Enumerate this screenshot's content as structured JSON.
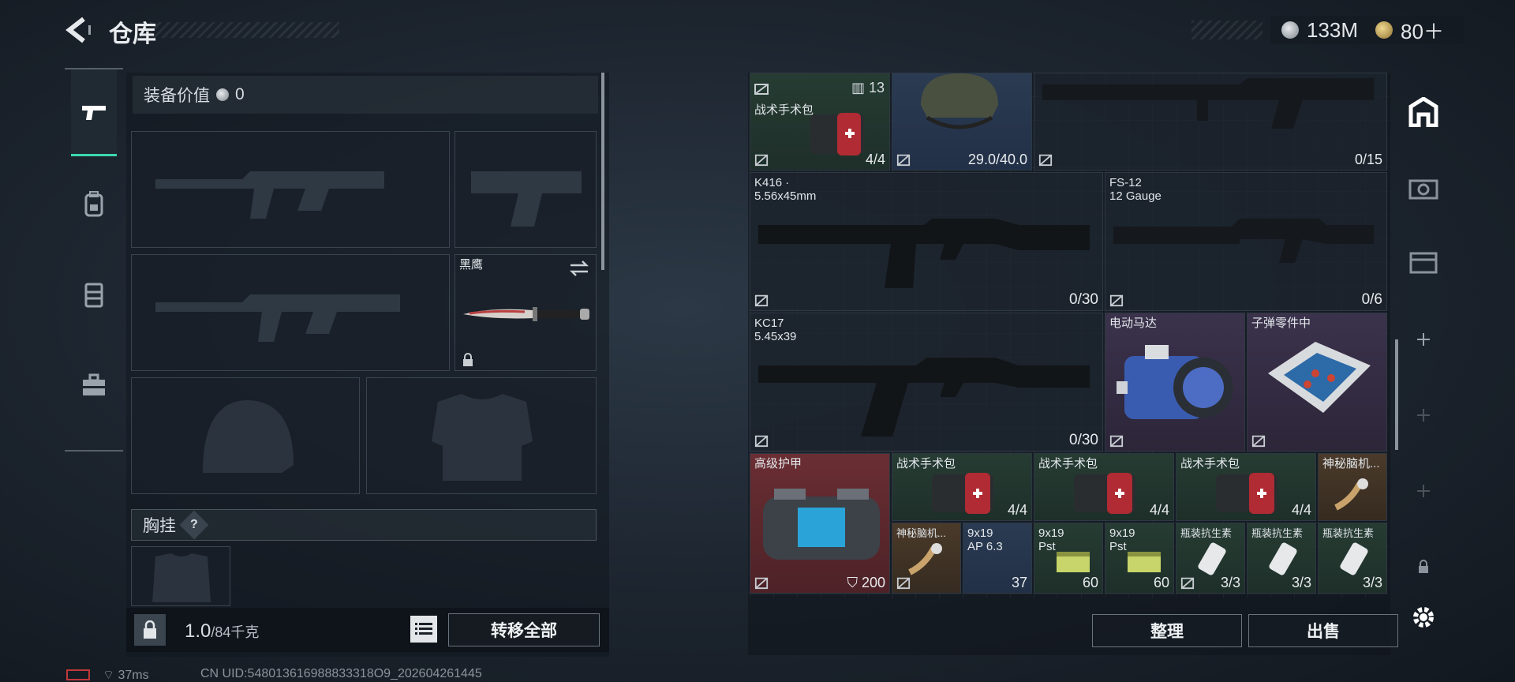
{
  "header": {
    "title": "仓库",
    "currency": [
      {
        "icon": "silver-coin-icon",
        "value": "133M"
      },
      {
        "icon": "gold-coin-icon",
        "value": "80＋"
      }
    ]
  },
  "equipment": {
    "value_label": "装备价值",
    "value": "0",
    "knife_name": "黑鹰",
    "chest_rig_label": "胸挂",
    "help_mark": "?",
    "weight": "1.0",
    "weight_max": "/84千克",
    "transfer_all": "转移全部"
  },
  "stash": {
    "items": [
      {
        "name": "战术手术包",
        "count": "4/4",
        "badge": "13"
      },
      {
        "name": "",
        "count": "29.0/40.0"
      },
      {
        "name": "",
        "count": "0/15"
      },
      {
        "name": "K416 ·",
        "sub": "5.56x45mm",
        "count": "0/30"
      },
      {
        "name": "FS-12",
        "sub": "12 Gauge",
        "count": "0/6"
      },
      {
        "name": "KC17",
        "sub": "5.45x39",
        "count": "0/30"
      },
      {
        "name": "电动马达",
        "count": ""
      },
      {
        "name": "子弹零件中",
        "count": ""
      },
      {
        "name": "高级护甲",
        "count": "200"
      },
      {
        "name": "战术手术包",
        "count": "4/4"
      },
      {
        "name": "战术手术包",
        "count": "4/4"
      },
      {
        "name": "战术手术包",
        "count": "4/4"
      },
      {
        "name": "神秘脑机...",
        "count": ""
      },
      {
        "name": "神秘脑机...",
        "count": ""
      },
      {
        "name": "9x19",
        "sub": "AP 6.3",
        "count": "37"
      },
      {
        "name": "9x19",
        "sub": "Pst",
        "count": "60"
      },
      {
        "name": "9x19",
        "sub": "Pst",
        "count": "60"
      },
      {
        "name": "瓶装抗生素",
        "count": "3/3"
      },
      {
        "name": "瓶装抗生素",
        "count": "3/3"
      },
      {
        "name": "瓶装抗生素",
        "count": "3/3"
      }
    ],
    "sort_label": "整理",
    "sell_label": "出售"
  },
  "footer": {
    "ping": "37ms",
    "uid": "CN UID:548013616988833318O9_202604261445"
  },
  "colors": {
    "accent": "#3fd6b0",
    "armor_red": "#6a2e33"
  }
}
